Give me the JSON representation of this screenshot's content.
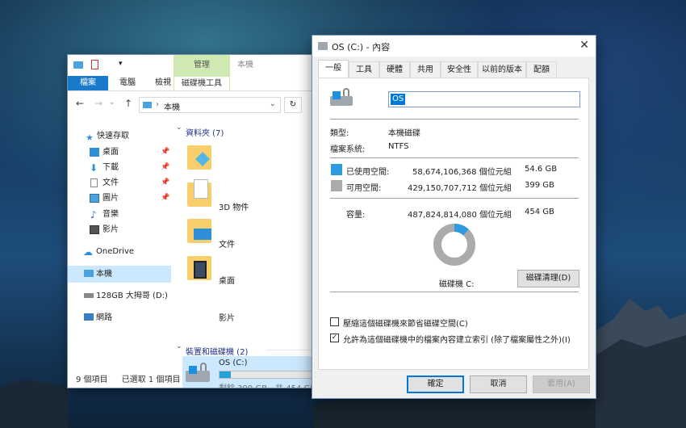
{
  "explorer": {
    "quick_tab_label": "管理",
    "title": "本機",
    "ribbon_tabs": [
      "檔案",
      "電腦",
      "檢視",
      "磁碟機工具"
    ],
    "address_path": "本機",
    "nav": {
      "quick_access": "快速存取",
      "items": [
        "桌面",
        "下載",
        "文件",
        "圖片",
        "音樂",
        "影片"
      ],
      "onedrive": "OneDrive",
      "this_pc": "本機",
      "drive_d": "128GB 大拇哥 (D:)",
      "network": "網路"
    },
    "folders_group": "資料夾 (7)",
    "folders": [
      "3D 物件",
      "文件",
      "桌面",
      "影片"
    ],
    "devices_group": "裝置和磁碟機 (2)",
    "drive": {
      "name": "OS (C:)",
      "free_text": "剩餘 399 GB，共 454 GB",
      "used_fraction": 0.12
    },
    "status_items": "9 個項目",
    "status_selected": "已選取 1 個項目"
  },
  "dialog": {
    "title": "OS (C:) - 內容",
    "close_label": "✕",
    "tabs": [
      "一般",
      "工具",
      "硬體",
      "共用",
      "安全性",
      "以前的版本",
      "配額"
    ],
    "name_value": "OS",
    "type_label": "類型:",
    "type_value": "本機磁碟",
    "fs_label": "檔案系統:",
    "fs_value": "NTFS",
    "used_label": "已使用空間:",
    "used_bytes": "58,674,106,368 個位元組",
    "used_gb": "54.6 GB",
    "free_label": "可用空間:",
    "free_bytes": "429,150,707,712 個位元組",
    "free_gb": "399 GB",
    "cap_label": "容量:",
    "cap_bytes": "487,824,814,080 個位元組",
    "cap_gb": "454 GB",
    "used_fraction": 0.12,
    "drive_label": "磁碟機 C:",
    "cleanup_label": "磁碟清理(D)",
    "compress_label": "壓縮這個磁碟機來節省磁碟空間(C)",
    "compress_checked": false,
    "index_label": "允許為這個磁碟機中的檔案內容建立索引 (除了檔案屬性之外)(I)",
    "index_checked": true,
    "ok_label": "確定",
    "cancel_label": "取消",
    "apply_label": "套用(A)",
    "colors": {
      "used": "#2d9be0",
      "free": "#ababab"
    }
  }
}
